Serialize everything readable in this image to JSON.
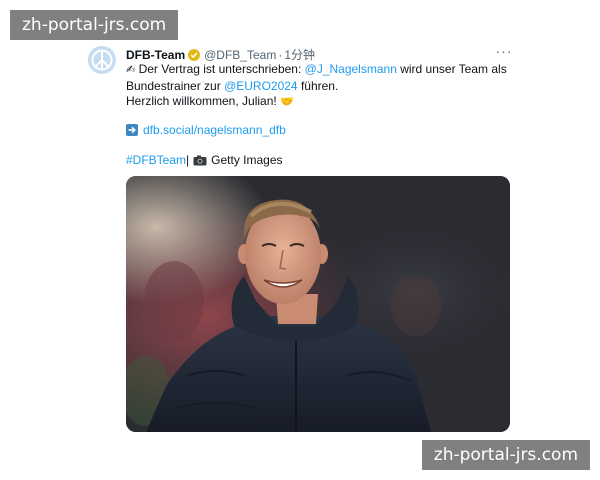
{
  "watermark": {
    "text": "zh-portal-jrs.com"
  },
  "tweet": {
    "author_name": "DFB-Team",
    "handle": "@DFB_Team",
    "separator": "·",
    "time": "1分钟",
    "more_label": "···",
    "line1_pre": "Der Vertrag ist unterschrieben: ",
    "line1_mention": "@J_Nagelsmann",
    "line1_post": " wird unser Team als",
    "line2_pre": "Bundestrainer zur ",
    "line2_mention": "@EURO2024",
    "line2_post": " führen.",
    "line3": "Herzlich willkommen, Julian!",
    "link_text": "dfb.social/nagelsmann_dfb",
    "hashtag": "#DFBTeam",
    "hashtag_sep": " |",
    "credit": "Getty Images"
  },
  "icons": {
    "avatar": "peace-logo-icon",
    "verified": "verified-badge-icon",
    "pen": "writing-hand-icon",
    "hands": "handshake-icon",
    "arrow": "right-arrow-icon",
    "camera": "camera-icon"
  },
  "colors": {
    "link": "#1d9bf0",
    "muted": "#536471",
    "verified": "#e2b719",
    "text": "#0f1419"
  }
}
